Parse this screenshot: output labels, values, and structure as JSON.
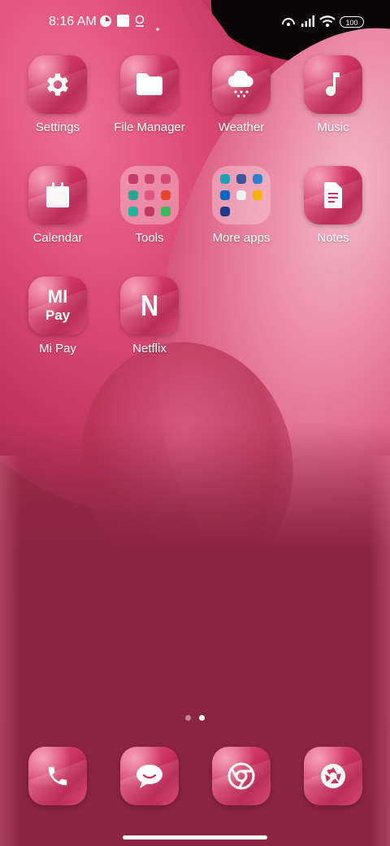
{
  "status_bar": {
    "time": "8:16 AM",
    "battery": "100",
    "icons": [
      "notification-app-icon",
      "square-icon",
      "location-icon",
      "dot-icon",
      "hotspot-icon",
      "signal-icon",
      "wifi-icon",
      "battery-icon"
    ]
  },
  "apps": [
    {
      "label": "Settings",
      "icon": "gear-icon"
    },
    {
      "label": "File Manager",
      "icon": "folder-icon"
    },
    {
      "label": "Weather",
      "icon": "cloud-snow-icon"
    },
    {
      "label": "Music",
      "icon": "music-note-icon"
    },
    {
      "label": "Calendar",
      "icon": "calendar-icon"
    },
    {
      "label": "Tools",
      "icon": "folder-group-icon"
    },
    {
      "label": "More apps",
      "icon": "folder-group-icon"
    },
    {
      "label": "Notes",
      "icon": "document-icon"
    },
    {
      "label": "Mi Pay",
      "icon": "mi-pay-icon",
      "icon_text_top": "MI",
      "icon_text_bottom": "Pay"
    },
    {
      "label": "Netflix",
      "icon": "netflix-icon",
      "icon_text": "N"
    }
  ],
  "page_indicator": {
    "pages": 2,
    "current": 2
  },
  "dock": [
    {
      "icon": "phone-icon"
    },
    {
      "icon": "messages-icon"
    },
    {
      "icon": "chrome-icon"
    },
    {
      "icon": "camera-icon"
    }
  ],
  "colors": {
    "tile_accent": "#d03866",
    "background": "#8c2540"
  }
}
